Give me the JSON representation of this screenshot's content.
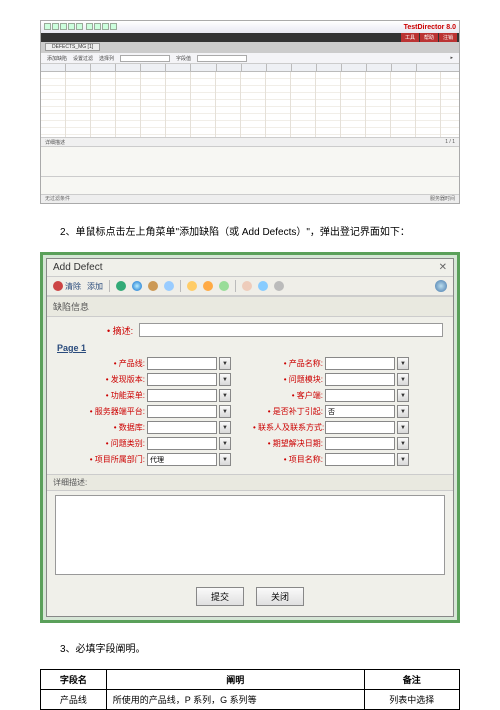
{
  "shot1": {
    "brand": "TestDirector 8.0",
    "tabs": [
      "工具",
      "帮助",
      "注销"
    ],
    "file_tab": "DEFECTS_MG [1]",
    "toolbar_labels": [
      "添加缺陷",
      "设置过滤",
      "选择列",
      "字段值"
    ],
    "nav": "1 / 1",
    "midbar_left": "详细描述",
    "status_left": "无过滤条件",
    "status_right": "服务器时间"
  },
  "caption2": "2、单鼠标点击左上角菜单\"添加缺陷（或 Add Defects）\"，弹出登记界面如下：",
  "dialog": {
    "title": "Add Defect",
    "tool_clear": "清除",
    "tool_add": "添加",
    "section_info": "缺陷信息",
    "summary_label": "摘述",
    "page_label": "Page 1",
    "detail_label": "详细描述:",
    "btn_submit": "提交",
    "btn_close": "关闭",
    "left_fields": [
      {
        "label": "产品线",
        "required": true
      },
      {
        "label": "发现版本",
        "required": true
      },
      {
        "label": "功能菜单",
        "required": true
      },
      {
        "label": "服务器端平台",
        "required": true
      },
      {
        "label": "数据库",
        "required": true
      },
      {
        "label": "问题类别",
        "required": true
      },
      {
        "label": "项目所属部门",
        "required": true,
        "value": "代理"
      }
    ],
    "right_fields": [
      {
        "label": "产品名称",
        "required": true
      },
      {
        "label": "问题模块",
        "required": true
      },
      {
        "label": "客户端",
        "required": true
      },
      {
        "label": "是否补丁引起",
        "required": true,
        "value": "否"
      },
      {
        "label": "联系人及联系方式",
        "required": true
      },
      {
        "label": "期望解决日期",
        "required": true
      },
      {
        "label": "项目名称",
        "required": true
      }
    ]
  },
  "caption3": "3、必填字段阐明。",
  "table": {
    "headers": [
      "字段名",
      "阐明",
      "备注"
    ],
    "rows": [
      [
        "产品线",
        "所使用的产品线，P 系列，G 系列等",
        "列表中选择"
      ]
    ]
  }
}
